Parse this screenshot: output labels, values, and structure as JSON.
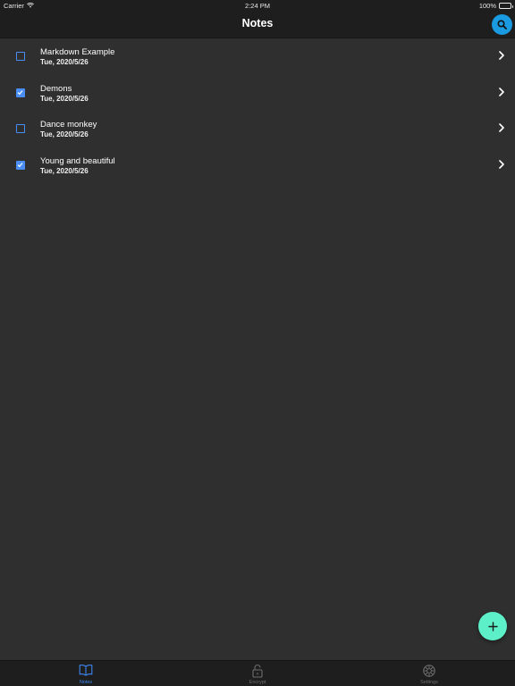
{
  "status_bar": {
    "carrier": "Carrier",
    "time": "2:24 PM",
    "battery": "100%"
  },
  "header": {
    "title": "Notes",
    "search_icon": "search-icon"
  },
  "notes": [
    {
      "title": "Markdown Example",
      "date": "Tue, 2020/5/26",
      "checked": false
    },
    {
      "title": "Demons",
      "date": "Tue, 2020/5/26",
      "checked": true
    },
    {
      "title": "Dance monkey",
      "date": "Tue, 2020/5/26",
      "checked": false
    },
    {
      "title": "Young and beautiful",
      "date": "Tue, 2020/5/26",
      "checked": true
    }
  ],
  "fab": {
    "icon": "plus-icon"
  },
  "tabs": [
    {
      "label": "Notes",
      "icon": "book-icon",
      "active": true
    },
    {
      "label": "Encrypt",
      "icon": "lock-icon",
      "active": false
    },
    {
      "label": "Settings",
      "icon": "gear-icon",
      "active": false
    }
  ],
  "colors": {
    "background": "#2f2f2f",
    "bar": "#1e1e1e",
    "accent": "#4a8ef5",
    "search_button": "#1a9ae0",
    "fab": "#5df0c8",
    "active_tab": "#3b86f0"
  }
}
